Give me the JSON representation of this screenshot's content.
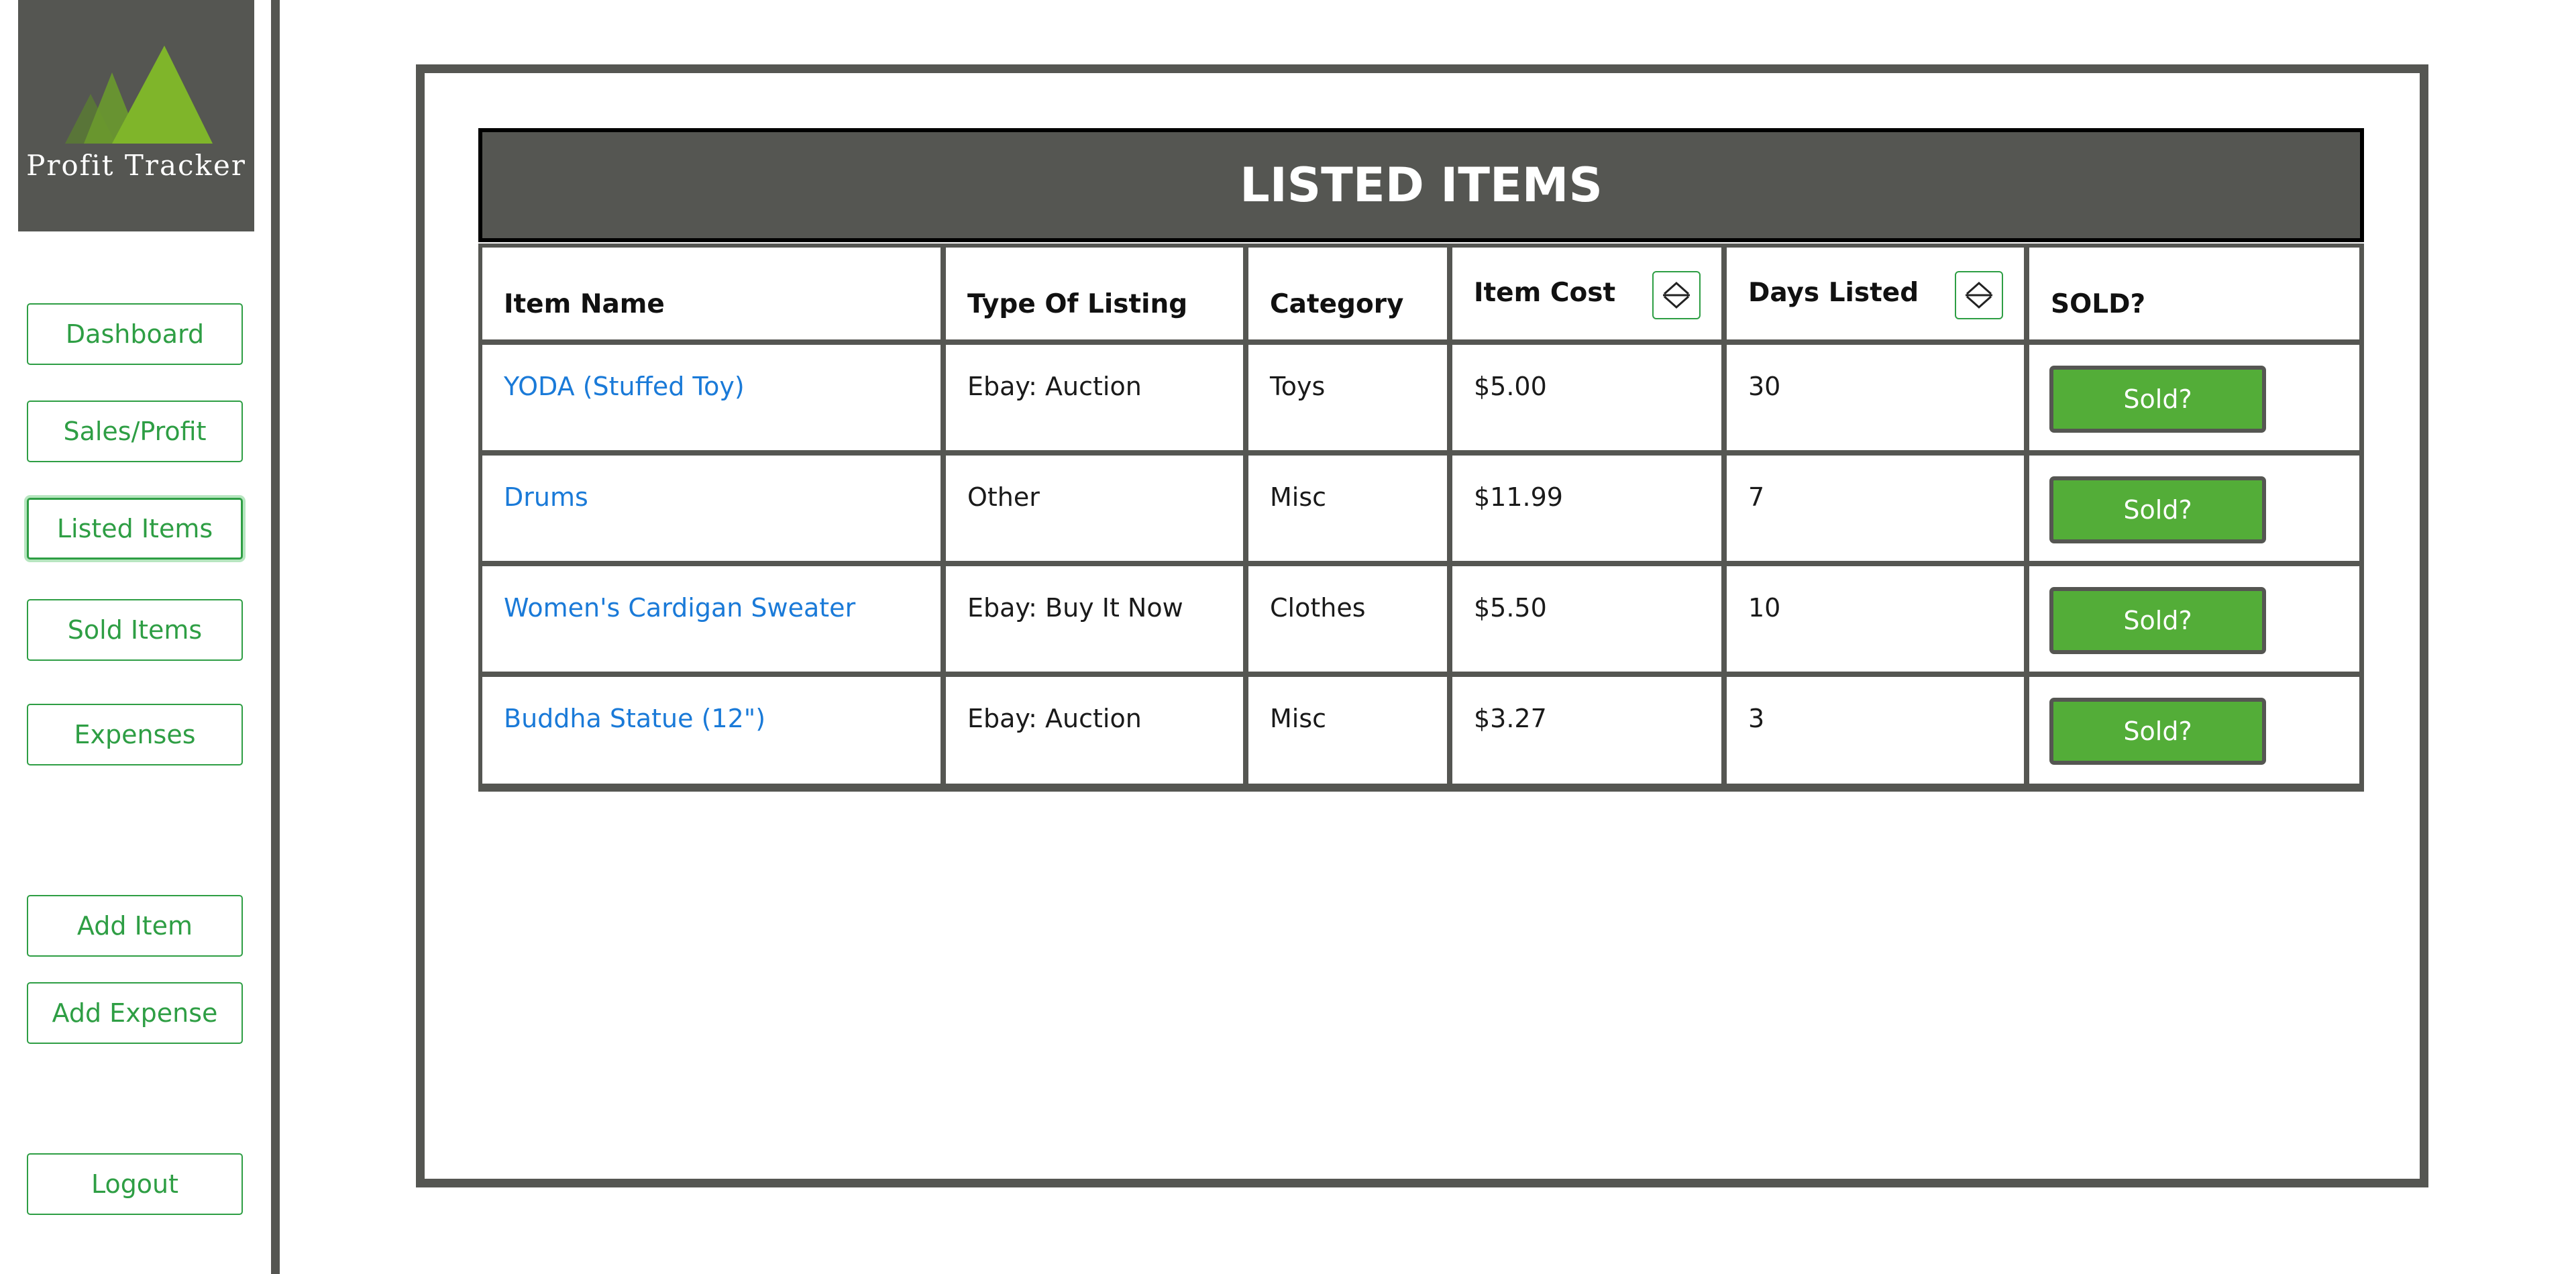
{
  "app": {
    "name": "Profit Tracker",
    "accent_color": "#2e9e44",
    "header_color": "#555652",
    "link_color": "#1a7ad8",
    "button_color": "#53ad38"
  },
  "sidebar": {
    "logo_icon": "mountains-icon",
    "items": [
      {
        "label": "Dashboard",
        "active": false
      },
      {
        "label": "Sales/Profit",
        "active": false
      },
      {
        "label": "Listed Items",
        "active": true
      },
      {
        "label": "Sold Items",
        "active": false
      },
      {
        "label": "Expenses",
        "active": false
      },
      {
        "label": "Add Item",
        "active": false
      },
      {
        "label": "Add Expense",
        "active": false
      },
      {
        "label": "Logout",
        "active": false
      }
    ]
  },
  "main": {
    "title": "LISTED ITEMS",
    "columns": [
      {
        "label": "Item Name",
        "sortable": false
      },
      {
        "label": "Type Of Listing",
        "sortable": false
      },
      {
        "label": "Category",
        "sortable": false
      },
      {
        "label": "Item Cost",
        "sortable": true,
        "sort_icon": "sort-up-down-icon"
      },
      {
        "label": "Days Listed",
        "sortable": true,
        "sort_icon": "sort-up-down-icon"
      },
      {
        "label": "SOLD?",
        "sortable": false
      }
    ],
    "rows": [
      {
        "name": "YODA (Stuffed Toy)",
        "type": "Ebay: Auction",
        "category": "Toys",
        "cost": "$5.00",
        "days": "30",
        "action": "Sold?"
      },
      {
        "name": "Drums",
        "type": "Other",
        "category": "Misc",
        "cost": "$11.99",
        "days": "7",
        "action": "Sold?"
      },
      {
        "name": "Women's Cardigan Sweater",
        "type": "Ebay: Buy It Now",
        "category": "Clothes",
        "cost": "$5.50",
        "days": "10",
        "action": "Sold?"
      },
      {
        "name": "Buddha Statue (12\")",
        "type": "Ebay: Auction",
        "category": "Misc",
        "cost": "$3.27",
        "days": "3",
        "action": "Sold?"
      }
    ]
  }
}
